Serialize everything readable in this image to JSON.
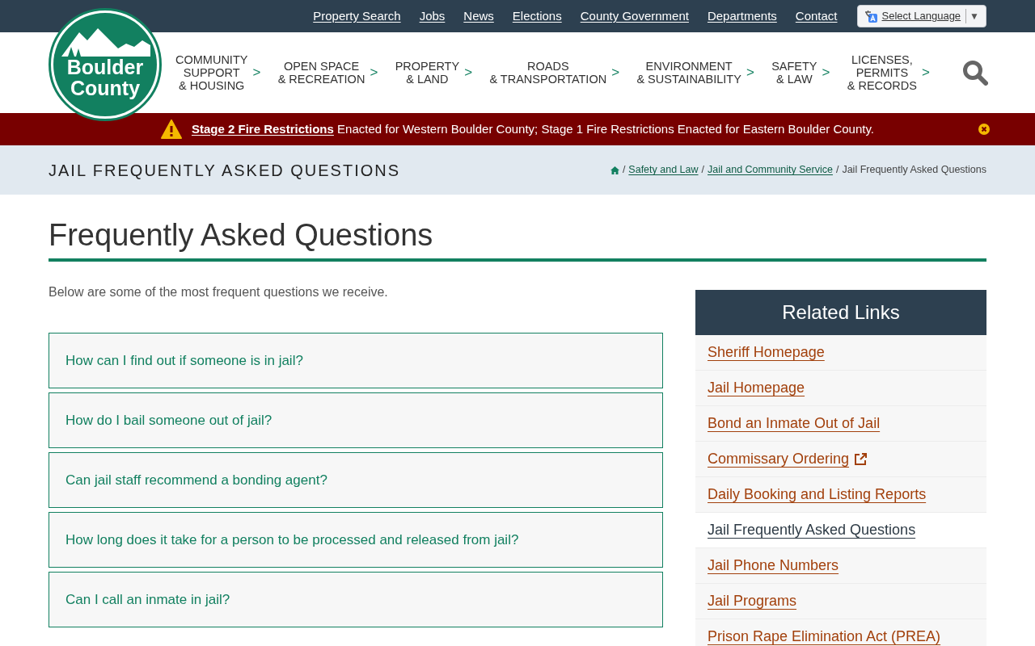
{
  "logo": {
    "lines": [
      "Boulder",
      "County"
    ]
  },
  "utility_nav": [
    "Property Search",
    "Jobs",
    "News",
    "Elections",
    "County Government",
    "Departments",
    "Contact"
  ],
  "language_select": {
    "label": "Select Language",
    "arrow": "▼"
  },
  "main_nav": [
    {
      "lines": [
        "COMMUNITY",
        "SUPPORT",
        "& HOUSING"
      ]
    },
    {
      "lines": [
        "OPEN SPACE",
        "& RECREATION"
      ]
    },
    {
      "lines": [
        "PROPERTY",
        "& LAND"
      ]
    },
    {
      "lines": [
        "ROADS",
        "& TRANSPORTATION"
      ]
    },
    {
      "lines": [
        "ENVIRONMENT",
        "& SUSTAINABILITY"
      ]
    },
    {
      "lines": [
        "SAFETY",
        "& LAW"
      ]
    },
    {
      "lines": [
        "LICENSES,",
        "PERMITS",
        "& RECORDS"
      ]
    }
  ],
  "nav_arrow": ">",
  "alert": {
    "link": "Stage 2 Fire Restrictions",
    "text": "Enacted for Western Boulder County; Stage 1 Fire Restrictions Enacted for Eastern Boulder County."
  },
  "page_band": {
    "title": "JAIL FREQUENTLY ASKED QUESTIONS",
    "breadcrumbs": [
      "Safety and Law",
      "Jail and Community Service"
    ],
    "current": "Jail Frequently Asked Questions",
    "separator": "/"
  },
  "heading": "Frequently Asked Questions",
  "intro": "Below are some of the most frequent questions we receive.",
  "faq": [
    {
      "question": "How can I find out if someone is in jail?"
    },
    {
      "question": "How do I bail someone out of jail?"
    },
    {
      "question": "Can jail staff recommend a bonding agent?"
    },
    {
      "question": "How long does it take for a person to be processed and released from jail?"
    },
    {
      "question": "Can I call an inmate in jail?"
    }
  ],
  "related_links": {
    "title": "Related Links",
    "items": [
      {
        "label": "Sheriff Homepage",
        "selected": false,
        "external": false
      },
      {
        "label": "Jail Homepage",
        "selected": false,
        "external": false
      },
      {
        "label": "Bond an Inmate Out of Jail",
        "selected": false,
        "external": false
      },
      {
        "label": "Commissary Ordering",
        "selected": false,
        "external": true
      },
      {
        "label": "Daily Booking and Listing Reports",
        "selected": false,
        "external": false
      },
      {
        "label": "Jail Frequently Asked Questions",
        "selected": true,
        "external": false
      },
      {
        "label": "Jail Phone Numbers",
        "selected": false,
        "external": false
      },
      {
        "label": "Jail Programs",
        "selected": false,
        "external": false
      },
      {
        "label": "Prison Rape Elimination Act (PREA)",
        "selected": false,
        "external": false
      }
    ]
  }
}
